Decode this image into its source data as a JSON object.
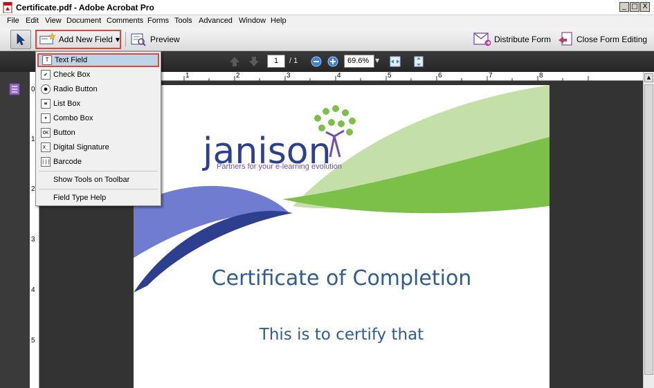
{
  "window": {
    "title": "Certificate.pdf - Adobe Acrobat Pro",
    "controls": [
      "_",
      "□",
      "X"
    ]
  },
  "menu": [
    "File",
    "Edit",
    "View",
    "Document",
    "Comments",
    "Forms",
    "Tools",
    "Advanced",
    "Window",
    "Help"
  ],
  "toolbar": {
    "add_field_label": "Add New Field",
    "preview_label": "Preview",
    "distribute_label": "Distribute Form",
    "close_edit_label": "Close Form Editing"
  },
  "nav": {
    "page_current": "1",
    "page_total": "/ 1",
    "zoom": "69.6%"
  },
  "dropdown": {
    "items": [
      {
        "label": "Text Field",
        "icon": "T",
        "selected": true
      },
      {
        "label": "Check Box",
        "icon": "✔"
      },
      {
        "label": "Radio Button",
        "icon": "●"
      },
      {
        "label": "List Box",
        "icon": "≡"
      },
      {
        "label": "Combo Box",
        "icon": "▾"
      },
      {
        "label": "Button",
        "icon": "OK"
      },
      {
        "label": "Digital Signature",
        "icon": "X_"
      },
      {
        "label": "Barcode",
        "icon": "|||"
      }
    ],
    "show_tools": "Show Tools on Toolbar",
    "help": "Field Type Help"
  },
  "rulers": {
    "horizontal_ticks": [
      "1",
      "2",
      "3",
      "4",
      "5",
      "6",
      "7",
      "8"
    ],
    "vertical_ticks": [
      "0",
      "1",
      "2",
      "3",
      "4",
      "5"
    ]
  },
  "document": {
    "logo_text": "janison",
    "tagline": "Partners for your e-learning evolution",
    "heading": "Certificate of Completion",
    "subheading": "This is to certify that"
  },
  "colors": {
    "highlight_border": "#e0443b",
    "brand_blue": "#2f3f8f",
    "brand_green": "#7cc04a",
    "heading_blue": "#2f5d93"
  }
}
